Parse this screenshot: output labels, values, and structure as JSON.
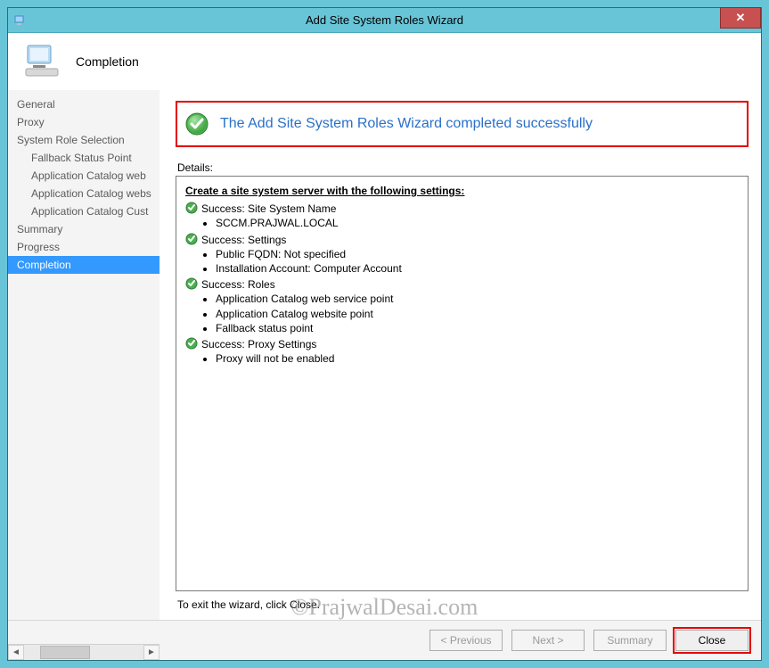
{
  "titlebar": {
    "title": "Add Site System Roles Wizard",
    "close_glyph": "✕"
  },
  "header": {
    "title": "Completion"
  },
  "sidebar": {
    "items": [
      {
        "label": "General",
        "sub": false,
        "selected": false
      },
      {
        "label": "Proxy",
        "sub": false,
        "selected": false
      },
      {
        "label": "System Role Selection",
        "sub": false,
        "selected": false
      },
      {
        "label": "Fallback Status Point",
        "sub": true,
        "selected": false
      },
      {
        "label": "Application Catalog web",
        "sub": true,
        "selected": false
      },
      {
        "label": "Application Catalog webs",
        "sub": true,
        "selected": false
      },
      {
        "label": "Application Catalog Cust",
        "sub": true,
        "selected": false
      },
      {
        "label": "Summary",
        "sub": false,
        "selected": false
      },
      {
        "label": "Progress",
        "sub": false,
        "selected": false
      },
      {
        "label": "Completion",
        "sub": false,
        "selected": true
      }
    ]
  },
  "banner": {
    "text": "The Add Site System Roles Wizard completed successfully"
  },
  "details": {
    "label": "Details:",
    "heading": "Create a site system server with the following settings:",
    "groups": [
      {
        "title": "Success: Site System Name",
        "items": [
          "SCCM.PRAJWAL.LOCAL"
        ]
      },
      {
        "title": "Success: Settings",
        "items": [
          "Public FQDN: Not specified",
          "Installation Account: Computer Account"
        ]
      },
      {
        "title": "Success: Roles",
        "items": [
          "Application Catalog web service point",
          "Application Catalog website point",
          "Fallback status point"
        ]
      },
      {
        "title": "Success: Proxy Settings",
        "items": [
          "Proxy will not be enabled"
        ]
      }
    ],
    "exit_hint": "To exit the wizard, click Close."
  },
  "buttons": {
    "previous": "< Previous",
    "next": "Next >",
    "summary": "Summary",
    "close": "Close"
  },
  "watermark": "©PrajwalDesai.com"
}
